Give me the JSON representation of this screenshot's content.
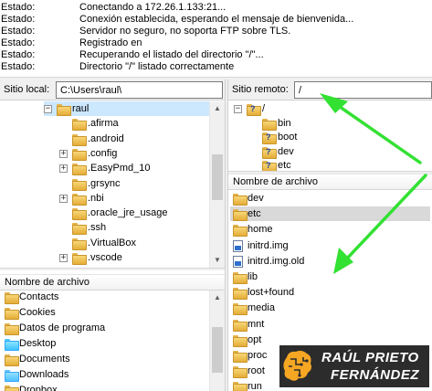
{
  "log": {
    "rows": [
      {
        "label": "Estado:",
        "text": "Conectando a 172.26.1.133:21..."
      },
      {
        "label": "Estado:",
        "text": "Conexión establecida, esperando el mensaje de bienvenida..."
      },
      {
        "label": "Estado:",
        "text": "Servidor no seguro, no soporta FTP sobre TLS."
      },
      {
        "label": "Estado:",
        "text": "Registrado en"
      },
      {
        "label": "Estado:",
        "text": "Recuperando el listado del directorio \"/\"..."
      },
      {
        "label": "Estado:",
        "text": "Directorio \"/\" listado correctamente"
      }
    ]
  },
  "local": {
    "site_label": "Sitio local:",
    "path": "C:\\Users\\raul\\",
    "tree": [
      {
        "label": "raul",
        "expander": "−",
        "type": "user"
      },
      {
        "label": ".afirma",
        "expander": "",
        "type": "folder"
      },
      {
        "label": ".android",
        "expander": "",
        "type": "folder"
      },
      {
        "label": ".config",
        "expander": "+",
        "type": "folder"
      },
      {
        "label": ".EasyPmd_10",
        "expander": "+",
        "type": "folder"
      },
      {
        "label": ".grsync",
        "expander": "",
        "type": "folder"
      },
      {
        "label": ".nbi",
        "expander": "+",
        "type": "folder"
      },
      {
        "label": ".oracle_jre_usage",
        "expander": "",
        "type": "folder"
      },
      {
        "label": ".ssh",
        "expander": "",
        "type": "folder"
      },
      {
        "label": ".VirtualBox",
        "expander": "",
        "type": "folder"
      },
      {
        "label": ".vscode",
        "expander": "+",
        "type": "folder"
      }
    ],
    "list_header": "Nombre de archivo",
    "files": [
      {
        "label": "Contacts",
        "type": "folder"
      },
      {
        "label": "Cookies",
        "type": "folder"
      },
      {
        "label": "Datos de programa",
        "type": "folder"
      },
      {
        "label": "Desktop",
        "type": "desktop"
      },
      {
        "label": "Documents",
        "type": "folder"
      },
      {
        "label": "Downloads",
        "type": "download"
      },
      {
        "label": "Dropbox",
        "type": "folder"
      }
    ]
  },
  "remote": {
    "site_label": "Sitio remoto:",
    "path": "/",
    "tree": [
      {
        "label": "/",
        "expander": "−",
        "type": "qfolder"
      },
      {
        "label": "bin",
        "expander": "",
        "type": "folder"
      },
      {
        "label": "boot",
        "expander": "",
        "type": "qfolder"
      },
      {
        "label": "dev",
        "expander": "",
        "type": "qfolder"
      },
      {
        "label": "etc",
        "expander": "",
        "type": "qfolder"
      }
    ],
    "list_header": "Nombre de archivo",
    "files": [
      {
        "label": "dev",
        "type": "folder"
      },
      {
        "label": "etc",
        "type": "folder"
      },
      {
        "label": "home",
        "type": "folder"
      },
      {
        "label": "initrd.img",
        "type": "file"
      },
      {
        "label": "initrd.img.old",
        "type": "file"
      },
      {
        "label": "lib",
        "type": "folder"
      },
      {
        "label": "lost+found",
        "type": "folder"
      },
      {
        "label": "media",
        "type": "folder"
      },
      {
        "label": "mnt",
        "type": "folder"
      },
      {
        "label": "opt",
        "type": "folder"
      },
      {
        "label": "proc",
        "type": "folder"
      },
      {
        "label": "root",
        "type": "folder"
      },
      {
        "label": "run",
        "type": "folder"
      }
    ]
  },
  "logo": {
    "line1": "RAÚL PRIETO",
    "line2": "FERNÁNDEZ"
  },
  "colors": {
    "arrow": "#33e133",
    "selection": "#cce8ff",
    "folder": "#f2c55c",
    "logo_bg": "#2c2c2c",
    "logo_accent": "#f5a623"
  }
}
